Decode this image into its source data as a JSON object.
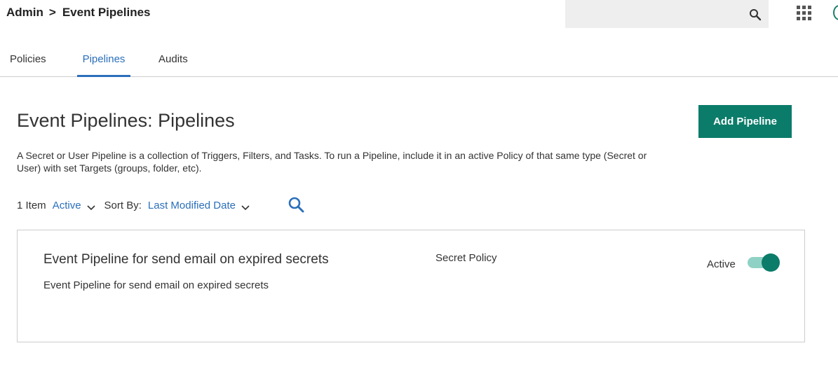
{
  "breadcrumb": {
    "parent": "Admin",
    "separator": ">",
    "current": "Event Pipelines"
  },
  "search": {
    "placeholder": "",
    "icon": "search-icon"
  },
  "apps": {
    "icon": "apps-grid-icon"
  },
  "tabs": [
    {
      "label": "Policies",
      "active": false
    },
    {
      "label": "Pipelines",
      "active": true
    },
    {
      "label": "Audits",
      "active": false
    }
  ],
  "page": {
    "title": "Event Pipelines: Pipelines",
    "add_button_label": "Add Pipeline",
    "description": "A Secret or User Pipeline is a collection of Triggers, Filters, and Tasks. To run a Pipeline, include it in an active Policy of that same type (Secret or User) with set Targets (groups, folder, etc)."
  },
  "filters": {
    "item_count": "1 Item",
    "status_value": "Active",
    "sort_label": "Sort By:",
    "sort_value": "Last Modified Date"
  },
  "pipelines": [
    {
      "name": "Event Pipeline for send email on expired secrets",
      "description": "Event Pipeline for send email on expired secrets",
      "type": "Secret Policy",
      "status_label": "Active",
      "active": true
    }
  ],
  "colors": {
    "accent": "#0b7c6a",
    "link": "#2b6fba",
    "toggle_track": "#8fd2c5"
  }
}
